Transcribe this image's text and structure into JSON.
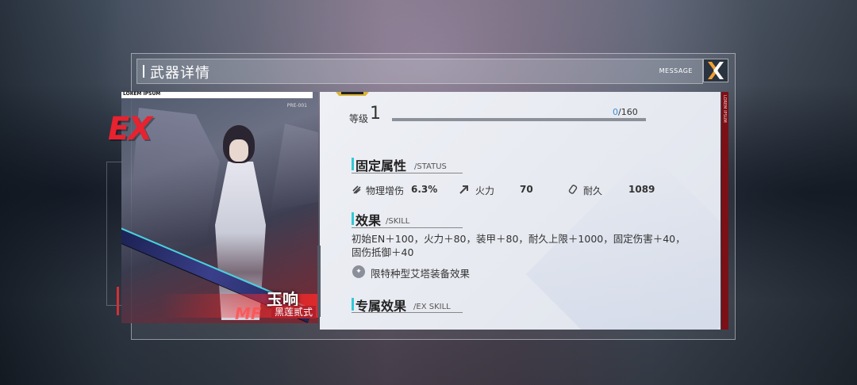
{
  "header": {
    "title": "武器详情",
    "message_label": "MESSAGE"
  },
  "card": {
    "top_label": "LOREM IPSUM",
    "code": "PRE-001",
    "rarity": "EX",
    "name": "玉响",
    "subtitle": "黑莲贰式",
    "watermark": "MF"
  },
  "panel": {
    "side_label": "LOREM IPSUM",
    "level_label": "等级",
    "level_value": "1",
    "xp_current": "0",
    "xp_max": "/160",
    "xp_progress": 0,
    "status": {
      "title": "固定属性",
      "subtitle": "/STATUS",
      "stats": [
        {
          "icon": "flame-icon",
          "label": "物理增伤",
          "value": "6.3%"
        },
        {
          "icon": "arrow-up-right-icon",
          "label": "火力",
          "value": "70"
        },
        {
          "icon": "shield-icon",
          "label": "耐久",
          "value": "1089"
        }
      ]
    },
    "skill": {
      "title": "效果",
      "subtitle": "/SKILL",
      "description": "初始EN＋100，火力＋80，装甲＋80，耐久上限＋1000，固定伤害＋40，固伤抵御＋40",
      "limit_text": "限特种型艾塔装备效果"
    },
    "ex_skill": {
      "title": "专属效果",
      "subtitle": "/EX SKILL"
    }
  },
  "colors": {
    "accent_cyan": "#33c8d6",
    "accent_red": "#e8222f",
    "xp_blue": "#3a8fd8",
    "close_orange": "#f0a030"
  }
}
